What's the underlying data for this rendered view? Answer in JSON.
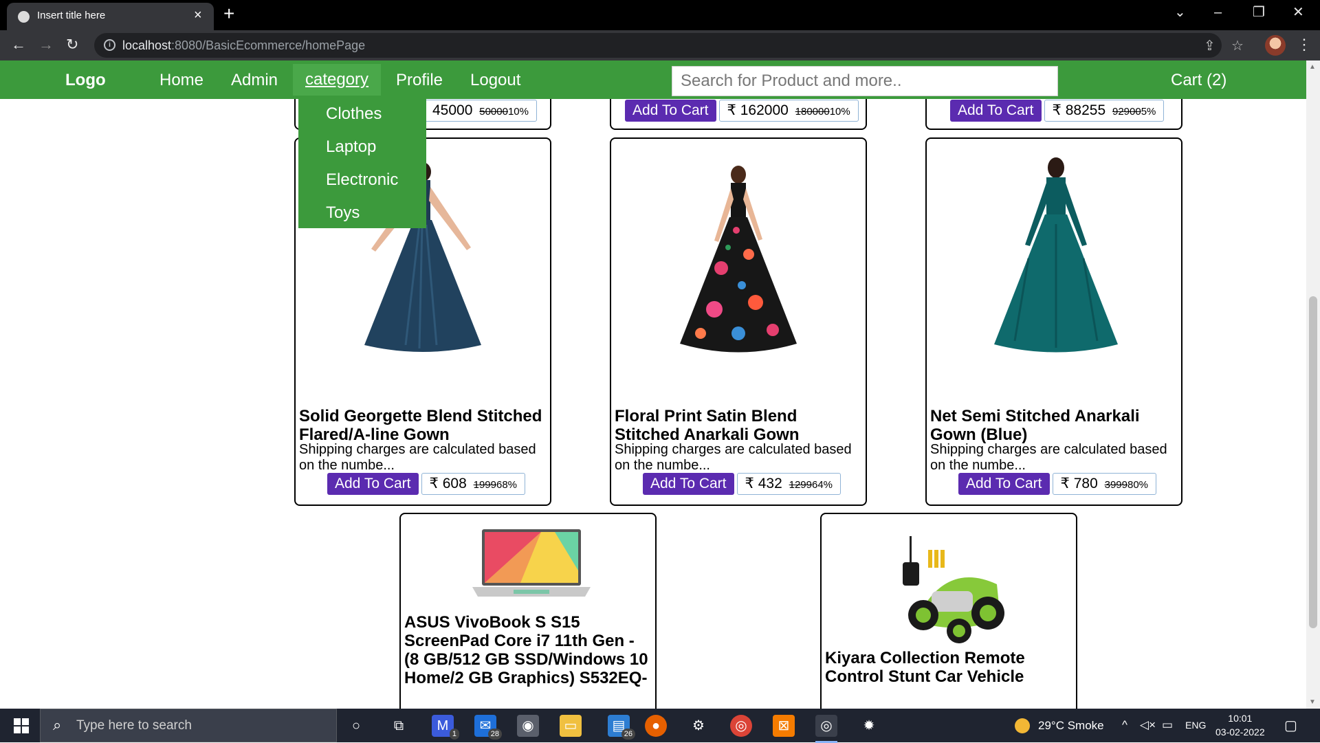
{
  "browser": {
    "tab_title": "Insert title here",
    "new_tab_glyph": "+",
    "url_host": "localhost",
    "url_path": ":8080/BasicEcommerce/homePage"
  },
  "site": {
    "logo": "Logo",
    "nav": [
      "Home",
      "Admin",
      "category",
      "Profile",
      "Logout"
    ],
    "search_placeholder": "Search for Product and more..",
    "cart": "Cart (2)",
    "category_menu": [
      "Clothes",
      "Laptop",
      "Electronic",
      "Toys"
    ]
  },
  "buttons": {
    "add_to_cart": "Add To Cart"
  },
  "top_row_prices": [
    {
      "price": "45000",
      "old": "50000",
      "off": "10%"
    },
    {
      "price": "162000",
      "old": "180000",
      "off": "10%"
    },
    {
      "price": "88255",
      "old": "92900",
      "off": "5%"
    }
  ],
  "products": [
    {
      "title": "Solid Georgette Blend Stitched Flared/A-line Gown",
      "desc": "Shipping charges are calculated based on the numbe...",
      "price": "608",
      "old": "1999",
      "off": "68%"
    },
    {
      "title": "Floral Print Satin Blend Stitched Anarkali Gown",
      "desc": "Shipping charges are calculated based on the numbe...",
      "price": "432",
      "old": "1299",
      "off": "64%"
    },
    {
      "title": "Net Semi Stitched Anarkali Gown (Blue)",
      "desc": "Shipping charges are calculated based on the numbe...",
      "price": "780",
      "old": "3999",
      "off": "80%"
    },
    {
      "title": "ASUS VivoBook S S15 ScreenPad Core i7 11th Gen - (8 GB/512 GB SSD/Windows 10 Home/2 GB Graphics) S532EQ-"
    },
    {
      "title": "Kiyara Collection Remote Control Stunt Car Vehicle"
    }
  ],
  "currency": "₹",
  "taskbar": {
    "search_placeholder": "Type here to search",
    "badges": {
      "mail": "28",
      "app1": "1",
      "app2": "26"
    },
    "weather": "29°C  Smoke",
    "lang": "ENG",
    "time": "10:01",
    "date": "03-02-2022"
  },
  "colors": {
    "nav_green": "#3c9a3c",
    "button_purple": "#5b2bb0"
  }
}
